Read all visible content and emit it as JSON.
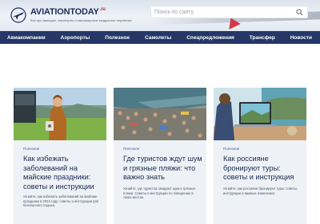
{
  "header": {
    "logo_text": "AVIATIONTODAY",
    "logo_suffix": ".ru",
    "tagline": "Все про авиацию, аэропорты и пассажирские воздушные перевозки",
    "search_placeholder": "Поиск по сайту",
    "search_icon": "search-icon"
  },
  "nav": {
    "items": [
      {
        "label": "Авиакомпании"
      },
      {
        "label": "Аэропорты"
      },
      {
        "label": "Полезное"
      },
      {
        "label": "Самолеты"
      },
      {
        "label": "Спецпредложения"
      },
      {
        "label": "Трансфер"
      },
      {
        "label": "Новости"
      }
    ]
  },
  "cards": [
    {
      "category": "Полезное",
      "title": "Как избежать заболеваний на майские праздники: советы и инструкции",
      "excerpt": "Узнайте, как избежать заболеваний на майские праздники в 2024 году: советы и инструкции для безопасного отдыха."
    },
    {
      "category": "Полезное",
      "title": "Где туристов ждут шум и грязные пляжи: что важно знать",
      "excerpt": "Узнайте, где туристов ожидают шум и грязные пляжи. Советы и инструкции по поведению в таких местах."
    },
    {
      "category": "Полезное",
      "title": "Как россияне бронируют туры: советы и инструкция",
      "excerpt": "Узнайте, как россияне бронируют туры: советы, инструкции и важные изменения."
    }
  ],
  "colors": {
    "nav_bg": "#243767",
    "accent_red": "#c2283b",
    "title_text": "#1c2a4f",
    "card_bg": "#eef1f6"
  }
}
